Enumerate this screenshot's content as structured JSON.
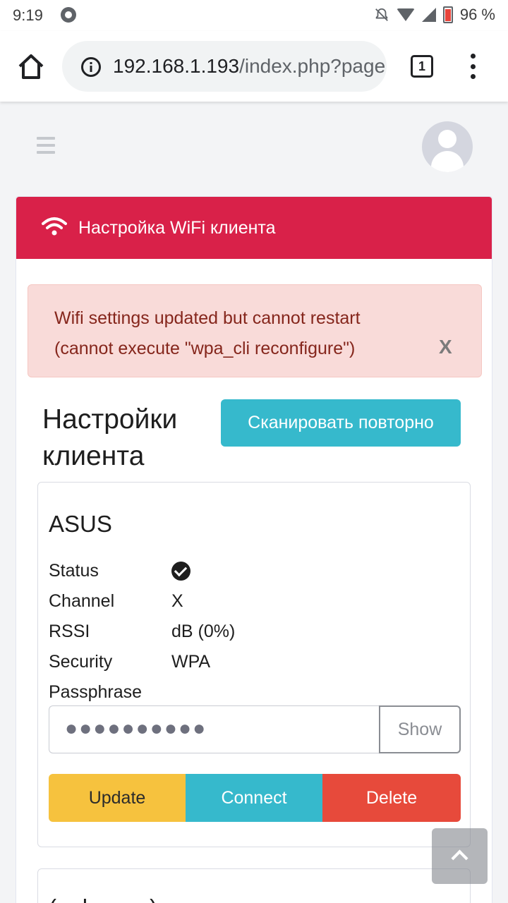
{
  "status_bar": {
    "time": "9:19",
    "battery": "96 %"
  },
  "browser": {
    "url_host": "192.168.1.193",
    "url_path": "/index.php?page",
    "tab_count": "1"
  },
  "card": {
    "title": "Настройка WiFi клиента",
    "header_color": "#d92149"
  },
  "alert": {
    "message": "Wifi settings updated but cannot restart (cannot execute \"wpa_cli reconfigure\")",
    "close_label": "X"
  },
  "section": {
    "title": "Настройки клиента",
    "rescan_button": "Сканировать повторно"
  },
  "network": {
    "ssid": "ASUS",
    "rows": [
      {
        "label": "Status",
        "value": ""
      },
      {
        "label": "Channel",
        "value": "X"
      },
      {
        "label": "RSSI",
        "value": "dB (0%)"
      },
      {
        "label": "Security",
        "value": "WPA"
      },
      {
        "label": "Passphrase",
        "value": ""
      }
    ],
    "passphrase_masked": "●●●●●●●●●●",
    "show_button": "Show",
    "update_button": "Update",
    "connect_button": "Connect",
    "delete_button": "Delete"
  },
  "network2": {
    "ssid": "(unknown)"
  },
  "colors": {
    "info": "#36b9cc",
    "warning": "#f6c23e",
    "danger": "#e74a3b"
  }
}
